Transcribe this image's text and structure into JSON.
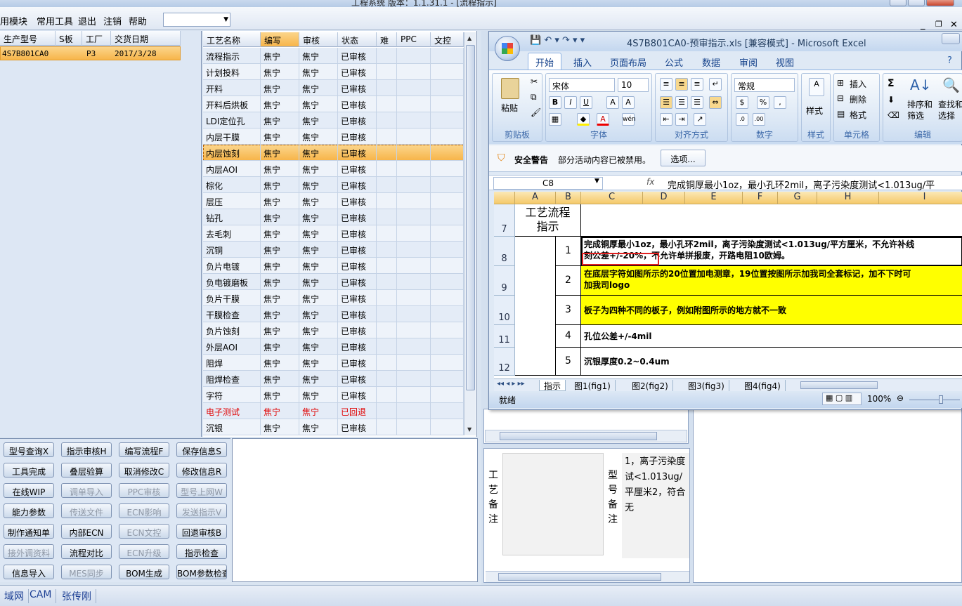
{
  "app": {
    "title": "工程系统  版本：1.1.31.1 - [流程指示]"
  },
  "menu": {
    "items": [
      "用模块",
      "常用工具",
      "退出",
      "注销",
      "帮助"
    ],
    "combo_value": ""
  },
  "left_table": {
    "headers": [
      "生产型号",
      "S板",
      "工厂",
      "交货日期"
    ],
    "rows": [
      {
        "model": "4S7B801CA0",
        "s": "",
        "factory": "P3",
        "date": "2017/3/28"
      }
    ]
  },
  "process_table": {
    "headers": [
      "工艺名称",
      "编写",
      "审核",
      "状态",
      "难",
      "PPC",
      "文控"
    ],
    "rows": [
      {
        "name": "流程指示",
        "writer": "焦宁",
        "reviewer": "焦宁",
        "status": "已审核"
      },
      {
        "name": "计划投料",
        "writer": "焦宁",
        "reviewer": "焦宁",
        "status": "已审核"
      },
      {
        "name": "开料",
        "writer": "焦宁",
        "reviewer": "焦宁",
        "status": "已审核"
      },
      {
        "name": "开料后烘板",
        "writer": "焦宁",
        "reviewer": "焦宁",
        "status": "已审核"
      },
      {
        "name": "LDI定位孔",
        "writer": "焦宁",
        "reviewer": "焦宁",
        "status": "已审核"
      },
      {
        "name": "内层干膜",
        "writer": "焦宁",
        "reviewer": "焦宁",
        "status": "已审核"
      },
      {
        "name": "内层蚀刻",
        "writer": "焦宁",
        "reviewer": "焦宁",
        "status": "已审核",
        "selected": true
      },
      {
        "name": "内层AOI",
        "writer": "焦宁",
        "reviewer": "焦宁",
        "status": "已审核"
      },
      {
        "name": "棕化",
        "writer": "焦宁",
        "reviewer": "焦宁",
        "status": "已审核"
      },
      {
        "name": "层压",
        "writer": "焦宁",
        "reviewer": "焦宁",
        "status": "已审核"
      },
      {
        "name": "钻孔",
        "writer": "焦宁",
        "reviewer": "焦宁",
        "status": "已审核"
      },
      {
        "name": "去毛刺",
        "writer": "焦宁",
        "reviewer": "焦宁",
        "status": "已审核"
      },
      {
        "name": "沉铜",
        "writer": "焦宁",
        "reviewer": "焦宁",
        "status": "已审核"
      },
      {
        "name": "负片电镀",
        "writer": "焦宁",
        "reviewer": "焦宁",
        "status": "已审核"
      },
      {
        "name": "负电镀磨板",
        "writer": "焦宁",
        "reviewer": "焦宁",
        "status": "已审核"
      },
      {
        "name": "负片干膜",
        "writer": "焦宁",
        "reviewer": "焦宁",
        "status": "已审核"
      },
      {
        "name": "干膜检查",
        "writer": "焦宁",
        "reviewer": "焦宁",
        "status": "已审核"
      },
      {
        "name": "负片蚀刻",
        "writer": "焦宁",
        "reviewer": "焦宁",
        "status": "已审核"
      },
      {
        "name": "外层AOI",
        "writer": "焦宁",
        "reviewer": "焦宁",
        "status": "已审核"
      },
      {
        "name": "阻焊",
        "writer": "焦宁",
        "reviewer": "焦宁",
        "status": "已审核"
      },
      {
        "name": "阻焊检查",
        "writer": "焦宁",
        "reviewer": "焦宁",
        "status": "已审核"
      },
      {
        "name": "字符",
        "writer": "焦宁",
        "reviewer": "焦宁",
        "status": "已审核"
      },
      {
        "name": "电子测试",
        "writer": "焦宁",
        "reviewer": "焦宁",
        "status": "已回退",
        "returned": true
      },
      {
        "name": "沉银",
        "writer": "焦宁",
        "reviewer": "焦宁",
        "status": "已审核"
      }
    ]
  },
  "buttons": [
    {
      "label": "型号查询X",
      "enabled": true
    },
    {
      "label": "指示审核H",
      "enabled": true
    },
    {
      "label": "编写流程F",
      "enabled": true
    },
    {
      "label": "保存信息S",
      "enabled": true
    },
    {
      "label": "工具完成",
      "enabled": true
    },
    {
      "label": "叠层验算",
      "enabled": true
    },
    {
      "label": "取消修改C",
      "enabled": true
    },
    {
      "label": "修改信息R",
      "enabled": true
    },
    {
      "label": "在线WIP",
      "enabled": true
    },
    {
      "label": "调单导入",
      "enabled": false
    },
    {
      "label": "PPC审核",
      "enabled": false
    },
    {
      "label": "型号上网W",
      "enabled": false
    },
    {
      "label": "能力参数",
      "enabled": true
    },
    {
      "label": "传送文件",
      "enabled": false
    },
    {
      "label": "ECN影响",
      "enabled": false
    },
    {
      "label": "发送指示V",
      "enabled": false
    },
    {
      "label": "制作通知单",
      "enabled": true
    },
    {
      "label": "内部ECN",
      "enabled": true
    },
    {
      "label": "ECN文控",
      "enabled": false
    },
    {
      "label": "回退审核B",
      "enabled": true
    },
    {
      "label": "接外调资料",
      "enabled": false
    },
    {
      "label": "流程对比",
      "enabled": true
    },
    {
      "label": "ECN升级",
      "enabled": false
    },
    {
      "label": "指示检查",
      "enabled": true
    },
    {
      "label": "信息导入",
      "enabled": true
    },
    {
      "label": "MES同步",
      "enabled": false
    },
    {
      "label": "BOM生成",
      "enabled": true
    },
    {
      "label": "BOM参数检查",
      "enabled": true
    }
  ],
  "notes": {
    "label1": "工艺备注",
    "label2": "型号备注",
    "text2": "1，离子污染度试<1.013ug/平厘米2，符合无"
  },
  "statusbar": [
    "域网",
    "CAM",
    "张传刚"
  ],
  "excel": {
    "title": "4S7B801CA0-预审指示.xls  [兼容模式] - Microsoft Excel",
    "tabs": [
      "开始",
      "插入",
      "页面布局",
      "公式",
      "数据",
      "审阅",
      "视图"
    ],
    "font_name": "宋体",
    "font_size": "10",
    "number_format": "常规",
    "groups": [
      "剪贴板",
      "字体",
      "对齐方式",
      "数字",
      "样式",
      "单元格",
      "编辑"
    ],
    "paste": "粘贴",
    "style": "样式",
    "cells_btns": [
      "插入",
      "删除",
      "格式"
    ],
    "edit_btns": [
      "排序和筛选",
      "查找和选择"
    ],
    "security_title": "安全警告",
    "security_msg": "部分活动内容已被禁用。",
    "options_btn": "选项...",
    "namebox": "C8",
    "fx": "fx",
    "formula": "完成铜厚最小1oz，最小孔环2mil，离子污染度测试<1.013ug/平",
    "columns": [
      "A",
      "B",
      "C",
      "D",
      "E",
      "F",
      "G",
      "H",
      "I"
    ],
    "header_cell": "工艺流程指示",
    "rows": [
      {
        "row": "7"
      },
      {
        "row": "8",
        "no": "1",
        "text": "完成铜厚最小1oz，最小孔环2mil，离子污染度测试<1.013ug/平方厘米，不允许补线",
        "text2": "刻公差+/-20%，不允许单拼报废，开路电阻10欧姆。"
      },
      {
        "row": "9",
        "no": "2",
        "text": "在底层字符如图所示的20位置加电测章，19位置按图所示加我司全套标记，加不下时可",
        "text2": "加我司logo",
        "yellow": true
      },
      {
        "row": "10",
        "no": "3",
        "text": "板子为四种不同的板子，例如附图所示的地方就不一致",
        "yellow": true
      },
      {
        "row": "11",
        "no": "4",
        "text": "孔位公差+/-4mil"
      },
      {
        "row": "12",
        "no": "5",
        "text": "沉银厚度0.2~0.4um"
      }
    ],
    "sheet_tabs": [
      "指示",
      "图1(fig1)",
      "图2(fig2)",
      "图3(fig3)",
      "图4(fig4)"
    ],
    "status": "就绪",
    "zoom": "100%"
  }
}
